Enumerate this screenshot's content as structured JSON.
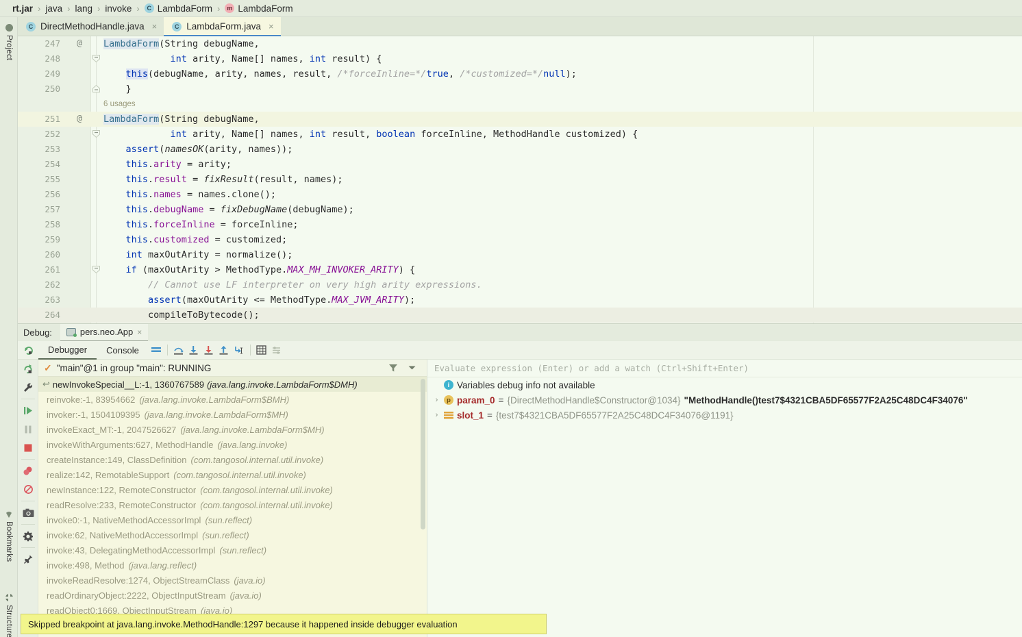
{
  "breadcrumb": {
    "items": [
      {
        "label": "rt.jar",
        "bold": true,
        "icon": null
      },
      {
        "label": "java",
        "bold": false,
        "icon": null
      },
      {
        "label": "lang",
        "bold": false,
        "icon": null
      },
      {
        "label": "invoke",
        "bold": false,
        "icon": null
      },
      {
        "label": "LambdaForm",
        "bold": false,
        "icon": "class-icon"
      },
      {
        "label": "LambdaForm",
        "bold": false,
        "icon": "method-icon"
      }
    ]
  },
  "left_toolbar": {
    "project": "Project",
    "bookmarks": "Bookmarks",
    "structure": "Structure"
  },
  "editor_tabs": [
    {
      "label": "DirectMethodHandle.java",
      "active": false,
      "icon": "java-class-icon",
      "close": "×"
    },
    {
      "label": "LambdaForm.java",
      "active": true,
      "icon": "java-class-icon",
      "close": "×"
    }
  ],
  "editor": {
    "lines": [
      {
        "num": "247",
        "ann": "@",
        "fold": null,
        "current": false,
        "indent": 18,
        "parts": [
          {
            "t": "decl",
            "s": "LambdaForm"
          },
          {
            "t": "p",
            "s": "(String debugName,"
          }
        ]
      },
      {
        "num": "248",
        "ann": "",
        "fold": "minus",
        "current": false,
        "indent": 18,
        "parts": [
          {
            "t": "p",
            "s": "            "
          },
          {
            "t": "kw",
            "s": "int"
          },
          {
            "t": "p",
            "s": " arity, Name[] names, "
          },
          {
            "t": "kw",
            "s": "int"
          },
          {
            "t": "p",
            "s": " result) {"
          }
        ]
      },
      {
        "num": "249",
        "ann": "",
        "fold": null,
        "current": false,
        "indent": 18,
        "parts": [
          {
            "t": "p",
            "s": "    "
          },
          {
            "t": "this",
            "s": "this"
          },
          {
            "t": "p",
            "s": "(debugName, arity, names, result, "
          },
          {
            "t": "cmt",
            "s": "/*forceInline=*/"
          },
          {
            "t": "kw",
            "s": "true"
          },
          {
            "t": "p",
            "s": ", "
          },
          {
            "t": "cmt",
            "s": "/*customized=*/"
          },
          {
            "t": "kw",
            "s": "null"
          },
          {
            "t": "p",
            "s": ");"
          }
        ]
      },
      {
        "num": "250",
        "ann": "",
        "fold": "collapse",
        "current": false,
        "indent": 18,
        "parts": [
          {
            "t": "p",
            "s": "    }"
          }
        ]
      },
      {
        "num": "",
        "ann": "",
        "fold": null,
        "current": false,
        "usage": "6 usages",
        "indent": 18,
        "parts": []
      },
      {
        "num": "251",
        "ann": "@",
        "fold": null,
        "current": true,
        "indent": 18,
        "parts": [
          {
            "t": "decl",
            "s": "LambdaForm"
          },
          {
            "t": "p",
            "s": "(String debugName,"
          }
        ]
      },
      {
        "num": "252",
        "ann": "",
        "fold": "minus",
        "current": false,
        "indent": 18,
        "parts": [
          {
            "t": "p",
            "s": "            "
          },
          {
            "t": "kw",
            "s": "int"
          },
          {
            "t": "p",
            "s": " arity, Name[] names, "
          },
          {
            "t": "kw",
            "s": "int"
          },
          {
            "t": "p",
            "s": " result, "
          },
          {
            "t": "kw",
            "s": "boolean"
          },
          {
            "t": "p",
            "s": " forceInline, MethodHandle customized) {"
          }
        ]
      },
      {
        "num": "253",
        "ann": "",
        "fold": null,
        "current": false,
        "indent": 18,
        "parts": [
          {
            "t": "p",
            "s": "    "
          },
          {
            "t": "kw",
            "s": "assert"
          },
          {
            "t": "p",
            "s": "("
          },
          {
            "t": "mi",
            "s": "namesOK"
          },
          {
            "t": "p",
            "s": "(arity, names));"
          }
        ]
      },
      {
        "num": "254",
        "ann": "",
        "fold": null,
        "current": false,
        "indent": 18,
        "parts": [
          {
            "t": "p",
            "s": "    "
          },
          {
            "t": "kw",
            "s": "this"
          },
          {
            "t": "p",
            "s": "."
          },
          {
            "t": "fld",
            "s": "arity"
          },
          {
            "t": "p",
            "s": " = arity;"
          }
        ]
      },
      {
        "num": "255",
        "ann": "",
        "fold": null,
        "current": false,
        "indent": 18,
        "parts": [
          {
            "t": "p",
            "s": "    "
          },
          {
            "t": "kw",
            "s": "this"
          },
          {
            "t": "p",
            "s": "."
          },
          {
            "t": "fld",
            "s": "result"
          },
          {
            "t": "p",
            "s": " = "
          },
          {
            "t": "mi",
            "s": "fixResult"
          },
          {
            "t": "p",
            "s": "(result, names);"
          }
        ]
      },
      {
        "num": "256",
        "ann": "",
        "fold": null,
        "current": false,
        "indent": 18,
        "parts": [
          {
            "t": "p",
            "s": "    "
          },
          {
            "t": "kw",
            "s": "this"
          },
          {
            "t": "p",
            "s": "."
          },
          {
            "t": "fld",
            "s": "names"
          },
          {
            "t": "p",
            "s": " = names.clone();"
          }
        ]
      },
      {
        "num": "257",
        "ann": "",
        "fold": null,
        "current": false,
        "indent": 18,
        "parts": [
          {
            "t": "p",
            "s": "    "
          },
          {
            "t": "kw",
            "s": "this"
          },
          {
            "t": "p",
            "s": "."
          },
          {
            "t": "fld",
            "s": "debugName"
          },
          {
            "t": "p",
            "s": " = "
          },
          {
            "t": "mi",
            "s": "fixDebugName"
          },
          {
            "t": "p",
            "s": "(debugName);"
          }
        ]
      },
      {
        "num": "258",
        "ann": "",
        "fold": null,
        "current": false,
        "indent": 18,
        "parts": [
          {
            "t": "p",
            "s": "    "
          },
          {
            "t": "kw",
            "s": "this"
          },
          {
            "t": "p",
            "s": "."
          },
          {
            "t": "fld",
            "s": "forceInline"
          },
          {
            "t": "p",
            "s": " = forceInline;"
          }
        ]
      },
      {
        "num": "259",
        "ann": "",
        "fold": null,
        "current": false,
        "indent": 18,
        "parts": [
          {
            "t": "p",
            "s": "    "
          },
          {
            "t": "kw",
            "s": "this"
          },
          {
            "t": "p",
            "s": "."
          },
          {
            "t": "fld",
            "s": "customized"
          },
          {
            "t": "p",
            "s": " = customized;"
          }
        ]
      },
      {
        "num": "260",
        "ann": "",
        "fold": null,
        "current": false,
        "indent": 18,
        "parts": [
          {
            "t": "p",
            "s": "    "
          },
          {
            "t": "kw",
            "s": "int"
          },
          {
            "t": "p",
            "s": " maxOutArity = normalize();"
          }
        ]
      },
      {
        "num": "261",
        "ann": "",
        "fold": "minus",
        "current": false,
        "indent": 18,
        "parts": [
          {
            "t": "p",
            "s": "    "
          },
          {
            "t": "kw",
            "s": "if"
          },
          {
            "t": "p",
            "s": " (maxOutArity > MethodType."
          },
          {
            "t": "cnst",
            "s": "MAX_MH_INVOKER_ARITY"
          },
          {
            "t": "p",
            "s": ") {"
          }
        ]
      },
      {
        "num": "262",
        "ann": "",
        "fold": null,
        "current": false,
        "indent": 18,
        "parts": [
          {
            "t": "p",
            "s": "        "
          },
          {
            "t": "cmt",
            "s": "// Cannot use LF interpreter on very high arity expressions."
          }
        ]
      },
      {
        "num": "263",
        "ann": "",
        "fold": null,
        "current": false,
        "indent": 18,
        "parts": [
          {
            "t": "p",
            "s": "        "
          },
          {
            "t": "kw",
            "s": "assert"
          },
          {
            "t": "p",
            "s": "(maxOutArity <= MethodType."
          },
          {
            "t": "cnst",
            "s": "MAX_JVM_ARITY"
          },
          {
            "t": "p",
            "s": ");"
          }
        ]
      },
      {
        "num": "264",
        "ann": "",
        "fold": null,
        "current": false,
        "hl": true,
        "indent": 18,
        "parts": [
          {
            "t": "p",
            "s": "        compileToBytecode();"
          }
        ]
      }
    ]
  },
  "debug": {
    "panel_label": "Debug:",
    "session_tab": "pers.neo.App",
    "session_close": "×",
    "tabs": [
      {
        "label": "Debugger",
        "selected": true
      },
      {
        "label": "Console",
        "selected": false
      }
    ],
    "toolbar_icons": [
      "layout-icon",
      "step-over-icon",
      "step-into-icon",
      "force-step-into-icon",
      "step-out-icon",
      "run-to-cursor-icon",
      "evaluate-expression-icon",
      "settings-list-icon"
    ],
    "side_icons": [
      "rerun-icon",
      "wrench-icon",
      "resume-icon",
      "pause-icon",
      "stop-icon",
      "view-breakpoints-icon",
      "mute-breakpoints-icon",
      "camera-icon",
      "settings-gear-icon",
      "pin-icon"
    ],
    "frames": {
      "thread_label": "\"main\"@1 in group \"main\": RUNNING",
      "filter_icon": "filter-icon",
      "dropdown_icon": "chevron-down-icon",
      "items": [
        {
          "name": "newInvokeSpecial__L:-1, 1360767589",
          "pkg": "(java.lang.invoke.LambdaForm$DMH)",
          "selected": true
        },
        {
          "name": "reinvoke:-1, 83954662",
          "pkg": "(java.lang.invoke.LambdaForm$BMH)",
          "selected": false
        },
        {
          "name": "invoker:-1, 1504109395",
          "pkg": "(java.lang.invoke.LambdaForm$MH)",
          "selected": false
        },
        {
          "name": "invokeExact_MT:-1, 2047526627",
          "pkg": "(java.lang.invoke.LambdaForm$MH)",
          "selected": false
        },
        {
          "name": "invokeWithArguments:627, MethodHandle",
          "pkg": "(java.lang.invoke)",
          "selected": false
        },
        {
          "name": "createInstance:149, ClassDefinition",
          "pkg": "(com.tangosol.internal.util.invoke)",
          "selected": false
        },
        {
          "name": "realize:142, RemotableSupport",
          "pkg": "(com.tangosol.internal.util.invoke)",
          "selected": false
        },
        {
          "name": "newInstance:122, RemoteConstructor",
          "pkg": "(com.tangosol.internal.util.invoke)",
          "selected": false
        },
        {
          "name": "readResolve:233, RemoteConstructor",
          "pkg": "(com.tangosol.internal.util.invoke)",
          "selected": false
        },
        {
          "name": "invoke0:-1, NativeMethodAccessorImpl",
          "pkg": "(sun.reflect)",
          "selected": false
        },
        {
          "name": "invoke:62, NativeMethodAccessorImpl",
          "pkg": "(sun.reflect)",
          "selected": false
        },
        {
          "name": "invoke:43, DelegatingMethodAccessorImpl",
          "pkg": "(sun.reflect)",
          "selected": false
        },
        {
          "name": "invoke:498, Method",
          "pkg": "(java.lang.reflect)",
          "selected": false
        },
        {
          "name": "invokeReadResolve:1274, ObjectStreamClass",
          "pkg": "(java.io)",
          "selected": false
        },
        {
          "name": "readOrdinaryObject:2222, ObjectInputStream",
          "pkg": "(java.io)",
          "selected": false
        },
        {
          "name": "readObject0:1669, ObjectInputStream",
          "pkg": "(java.io)",
          "selected": false
        }
      ]
    },
    "variables": {
      "eval_placeholder": "Evaluate expression (Enter) or add a watch (Ctrl+Shift+Enter)",
      "info_message": "Variables debug info not available",
      "rows": [
        {
          "icon": "param-icon",
          "name": "param_0",
          "eq": " = ",
          "value": "{DirectMethodHandle$Constructor@1034} ",
          "string": "\"MethodHandle()test7$4321CBA5DF65577F2A25C48DC4F34076\"",
          "expandable": true
        },
        {
          "icon": "slot-icon",
          "name": "slot_1",
          "eq": " = ",
          "value": "{test7$4321CBA5DF65577F2A25C48DC4F34076@1191}",
          "string": "",
          "expandable": true
        }
      ]
    }
  },
  "notification": {
    "message": "Skipped breakpoint at java.lang.invoke.MethodHandle:1297 because it happened inside debugger evaluation"
  }
}
